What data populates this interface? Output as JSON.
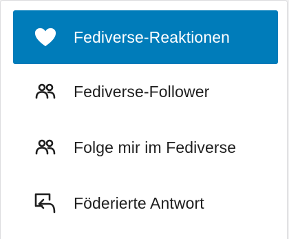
{
  "theme": {
    "accent": "#007cba",
    "text": "#1e1e1e"
  },
  "menu": {
    "items": [
      {
        "label": "Fediverse-Reaktionen",
        "icon": "heart-icon",
        "active": true
      },
      {
        "label": "Fediverse-Follower",
        "icon": "people-icon",
        "active": false
      },
      {
        "label": "Folge mir im Fediverse",
        "icon": "people-icon",
        "active": false
      },
      {
        "label": "Föderierte Antwort",
        "icon": "reply-arrow-icon",
        "active": false
      }
    ]
  }
}
